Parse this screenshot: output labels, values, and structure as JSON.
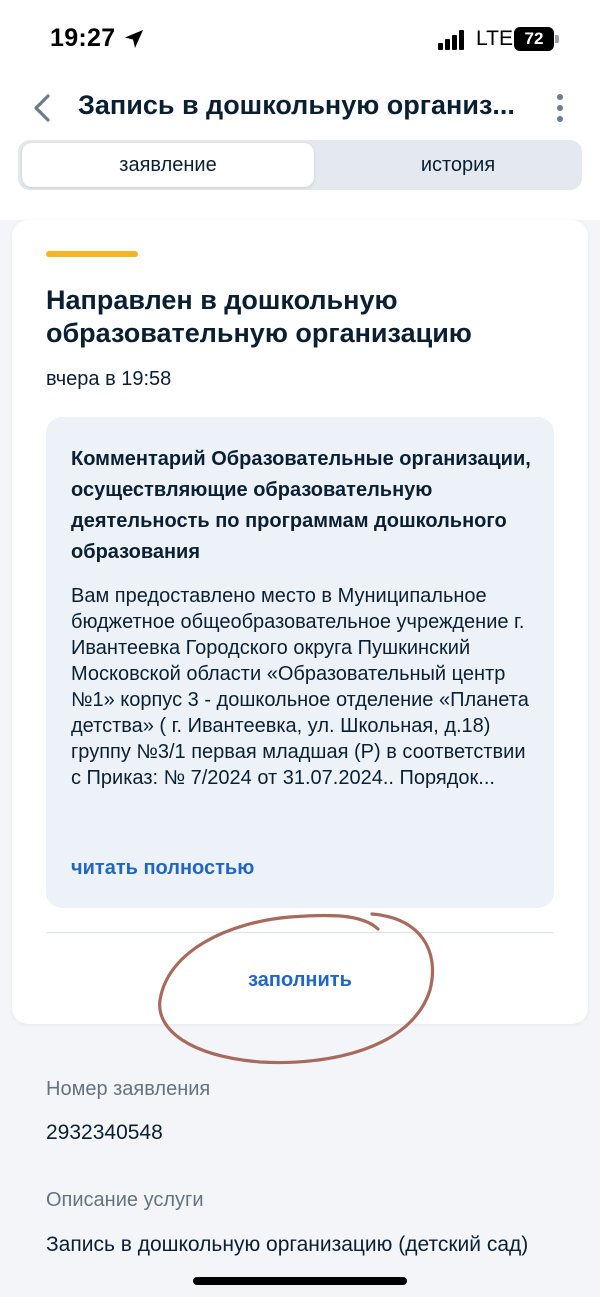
{
  "status_bar": {
    "time": "19:27",
    "network": "LTE",
    "battery": "72"
  },
  "header": {
    "title": "Запись в дошкольную организ...",
    "tabs": [
      {
        "label": "заявление",
        "active": true
      },
      {
        "label": "история",
        "active": false
      }
    ]
  },
  "card": {
    "accent_color": "#f5b622",
    "status_title": "Направлен в дошкольную образовательную организацию",
    "status_time": "вчера в 19:58",
    "comment": {
      "title": "Комментарий Образовательные организации, осуществляющие образовательную деятельность по программам дошкольного образования",
      "text": "Вам предоставлено место в Муниципальное бюджетное общеобразовательное учреждение г. Ивантеевка Городского округа Пушкинский Московской области «Образовательный центр №1» корпус 3 - дошкольное отделение «Планета детства» ( г. Ивантеевка, ул. Школьная, д.18) группу №3/1 первая младшая (Р) в соответствии с Приказ: № 7/2024 от 31.07.2024.. Порядок...",
      "read_more": "читать полностью"
    },
    "action_label": "заполнить"
  },
  "info": {
    "number_label": "Номер заявления",
    "number_value": "2932340548",
    "service_label": "Описание услуги",
    "service_value": "Запись в дошкольную организацию (детский сад)"
  },
  "colors": {
    "link": "#2166c3",
    "accent": "#f5b622",
    "annotation": "#a86a5c"
  }
}
